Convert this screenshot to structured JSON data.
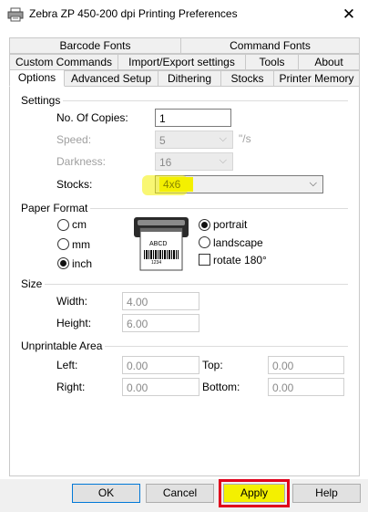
{
  "window": {
    "title": "Zebra  ZP 450-200 dpi Printing Preferences",
    "close_symbol": "✕"
  },
  "tabs": {
    "row1": [
      {
        "label": "Barcode Fonts"
      },
      {
        "label": "Command Fonts"
      }
    ],
    "row2": [
      {
        "label": "Custom Commands"
      },
      {
        "label": "Import/Export settings"
      },
      {
        "label": "Tools"
      },
      {
        "label": "About"
      }
    ],
    "row3": [
      {
        "label": "Options",
        "active": true
      },
      {
        "label": "Advanced Setup"
      },
      {
        "label": "Dithering"
      },
      {
        "label": "Stocks"
      },
      {
        "label": "Printer Memory"
      }
    ]
  },
  "settings": {
    "section_label": "Settings",
    "copies_label": "No. Of Copies:",
    "copies_value": "1",
    "speed_label": "Speed:",
    "speed_value": "5",
    "speed_unit": "\"/s",
    "darkness_label": "Darkness:",
    "darkness_value": "16",
    "stocks_label": "Stocks:",
    "stocks_value": "4x6"
  },
  "paper_format": {
    "section_label": "Paper Format",
    "units": [
      {
        "label": "cm",
        "checked": false
      },
      {
        "label": "mm",
        "checked": false
      },
      {
        "label": "inch",
        "checked": true
      }
    ],
    "label_text": "ABCD",
    "label_number": "1234",
    "orientation": [
      {
        "label": "portrait",
        "checked": true
      },
      {
        "label": "landscape",
        "checked": false
      }
    ],
    "rotate_label": "rotate 180°",
    "rotate_checked": false
  },
  "size": {
    "section_label": "Size",
    "width_label": "Width:",
    "width_value": "4.00",
    "height_label": "Height:",
    "height_value": "6.00"
  },
  "unprintable": {
    "section_label": "Unprintable Area",
    "left_label": "Left:",
    "left_value": "0.00",
    "top_label": "Top:",
    "top_value": "0.00",
    "right_label": "Right:",
    "right_value": "0.00",
    "bottom_label": "Bottom:",
    "bottom_value": "0.00"
  },
  "buttons": {
    "ok": "OK",
    "cancel": "Cancel",
    "apply": "Apply",
    "help": "Help"
  },
  "colors": {
    "highlight": "#f4f000",
    "apply_box": "#e0001b",
    "accent": "#0078d7"
  }
}
